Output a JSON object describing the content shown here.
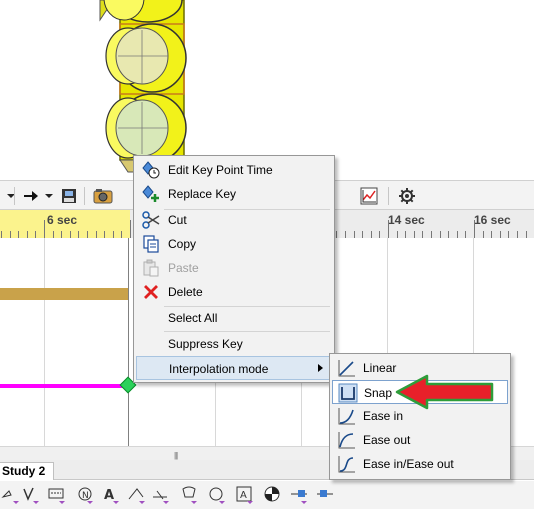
{
  "ruler": {
    "labels": [
      "6 sec",
      "14 sec",
      "16 sec"
    ]
  },
  "tabs": {
    "study_label": "Study 2"
  },
  "context_menu": {
    "items": [
      {
        "label": "Edit Key Point Time",
        "icon": "key-clock-icon",
        "enabled": true
      },
      {
        "label": "Replace Key",
        "icon": "key-plus-icon",
        "enabled": true
      },
      {
        "label": "Cut",
        "icon": "scissors-icon",
        "enabled": true
      },
      {
        "label": "Copy",
        "icon": "copy-icon",
        "enabled": true
      },
      {
        "label": "Paste",
        "icon": "paste-icon",
        "enabled": false
      },
      {
        "label": "Delete",
        "icon": "delete-x-icon",
        "enabled": true
      },
      {
        "label": "Select All",
        "enabled": true
      },
      {
        "label": "Suppress Key",
        "enabled": true
      },
      {
        "label": "Interpolation mode",
        "enabled": true,
        "has_submenu": true,
        "highlighted": true
      }
    ]
  },
  "interpolation_submenu": {
    "items": [
      {
        "label": "Linear",
        "icon": "linear-icon"
      },
      {
        "label": "Snap",
        "icon": "snap-icon",
        "selected": true
      },
      {
        "label": "Ease in",
        "icon": "ease-in-icon"
      },
      {
        "label": "Ease out",
        "icon": "ease-out-icon"
      },
      {
        "label": "Ease in/Ease out",
        "icon": "ease-in-out-icon"
      }
    ]
  },
  "colors": {
    "ruler_highlight": "#fbf38d",
    "gold_bar": "#c9a24a",
    "magenta_bar": "#ff00ff",
    "key_point": "#2bd15a",
    "pointer_arrow": "#e8202a",
    "pointer_arrow_outline": "#2e9d3a",
    "traffic_light_body": "#f2f21a"
  }
}
